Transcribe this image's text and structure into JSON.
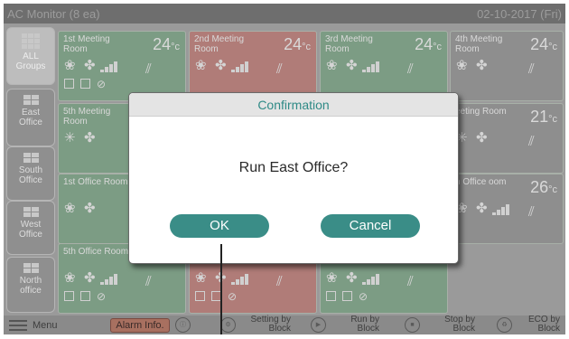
{
  "titlebar": {
    "title": "AC Monitor (8 ea)",
    "datetime": "02-10-2017 (Fri)"
  },
  "sidebar": [
    {
      "label": "ALL Groups"
    },
    {
      "label": "East Office"
    },
    {
      "label": "South Office"
    },
    {
      "label": "West Office"
    },
    {
      "label": "North office"
    }
  ],
  "rooms": [
    {
      "name": "1st Meeting Room",
      "temp": "24",
      "unit": "°c"
    },
    {
      "name": "2nd Meeting Room",
      "temp": "24",
      "unit": "°c"
    },
    {
      "name": "3rd Meeting Room",
      "temp": "24",
      "unit": "°c"
    },
    {
      "name": "4th Meeting Room",
      "temp": "24",
      "unit": "°c"
    },
    {
      "name": "5th Meeting Room",
      "temp": "",
      "unit": ""
    },
    {
      "name": "eeting Room",
      "temp": "21",
      "unit": "°c"
    },
    {
      "name": "1st Office Room",
      "temp": "",
      "unit": ""
    },
    {
      "name": "h Office oom",
      "temp": "26",
      "unit": "°c"
    },
    {
      "name": "5th Office Room",
      "temp": "",
      "unit": ""
    },
    {
      "name": "",
      "temp": "",
      "unit": ""
    },
    {
      "name": "",
      "temp": "",
      "unit": ""
    }
  ],
  "bottombar": {
    "menu": "Menu",
    "alarm": "Alarm Info.",
    "setting": "Setting by Block",
    "run": "Run by Block",
    "stop": "Stop by Block",
    "eco": "ECO by Block"
  },
  "dialog": {
    "title": "Confirmation",
    "message": "Run East Office?",
    "ok": "OK",
    "cancel": "Cancel"
  },
  "colors": {
    "accent": "#3a8d87",
    "tile_running": "#7c9c84",
    "tile_alarm": "#b07c78"
  }
}
